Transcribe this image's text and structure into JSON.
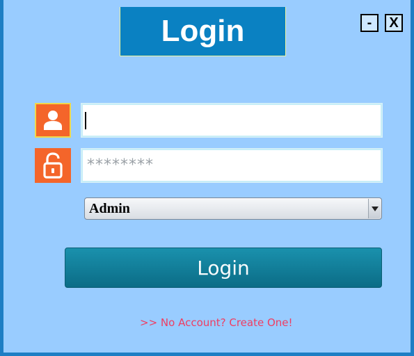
{
  "window": {
    "title": "Login",
    "minimize_label": "-",
    "close_label": "X"
  },
  "form": {
    "username": {
      "value": "",
      "icon": "user-icon"
    },
    "password": {
      "masked_value": "********",
      "icon": "lock-icon"
    },
    "role": {
      "selected": "Admin"
    },
    "login_button_label": "Login",
    "create_account_link": ">> No Account? Create One!"
  },
  "colors": {
    "background": "#99ccff",
    "title_bg": "#0a81c2",
    "icon_bg": "#f4652a",
    "button_bg": "#0f7d98",
    "link": "#ef3d62"
  }
}
